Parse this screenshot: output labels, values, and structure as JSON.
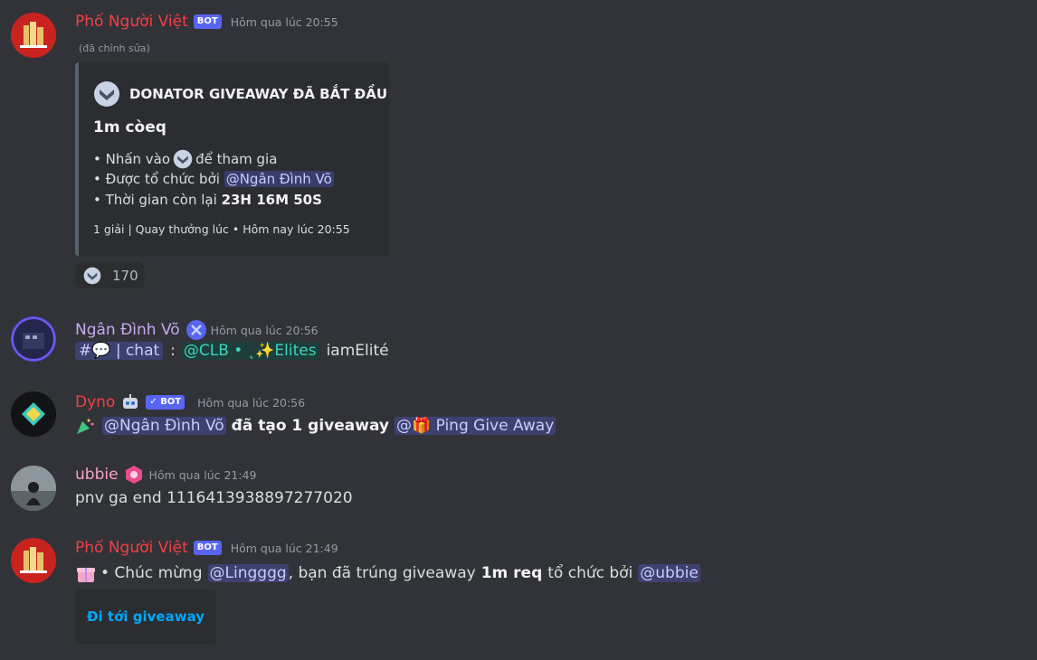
{
  "messages": {
    "m1": {
      "username": "Phố Người Việt",
      "username_color": "#f23f43",
      "bot_tag": "BOT",
      "timestamp": "Hôm qua lúc 20:55",
      "edited": "(đã chỉnh sửa)",
      "embed": {
        "title": "DONATOR GIVEAWAY ĐÃ BẮT ĐẦU",
        "prize": "1m còeq",
        "line1_pre": "• Nhấn vào",
        "line1_post": "để tham gia",
        "line2_pre": "• Được tổ chức bởi",
        "line2_mention": "@Ngân Đình Võ",
        "line3_pre": "• Thời gian còn lại",
        "line3_bold": "23H 16M 50S",
        "footer": "1 giải | Quay thưởng lúc • Hôm nay lúc 20:55"
      },
      "reaction_count": "170"
    },
    "m2": {
      "username": "Ngân Đình Võ",
      "username_color": "#c9a8f0",
      "timestamp": "Hôm qua lúc 20:56",
      "channel_mention": "#💬 | chat",
      "sep": ":",
      "role_mention": "@CLB • ˛✨Elites",
      "tail": "iamElité"
    },
    "m3": {
      "username": "Dyno",
      "username_color": "#f23f43",
      "bot_tag": "✓ BOT",
      "timestamp": "Hôm qua lúc 20:56",
      "mention": "@Ngân Đình Võ",
      "bold": "đã tạo 1 giveaway",
      "role_mention": "@🎁 Ping Give Away"
    },
    "m4": {
      "username": "ubbie",
      "username_color": "#f5a3c6",
      "timestamp": "Hôm qua lúc 21:49",
      "text": "pnv ga end 1116413938897277020"
    },
    "m5": {
      "username": "Phố Người Việt",
      "username_color": "#f23f43",
      "bot_tag": "BOT",
      "timestamp": "Hôm qua lúc 21:49",
      "pre": "• Chúc mừng",
      "mention": "@Lingggg",
      "mid": ", bạn đã trúng giveaway",
      "bold": "1m req",
      "mid2": "tổ chức bởi",
      "mention2": "@ubbie",
      "button": "Đi tới giveaway"
    }
  },
  "colors": {
    "background": "#313338",
    "embed_bg": "#2b2d31",
    "mention_bg": "#3c4270",
    "link": "#00a8fc"
  }
}
